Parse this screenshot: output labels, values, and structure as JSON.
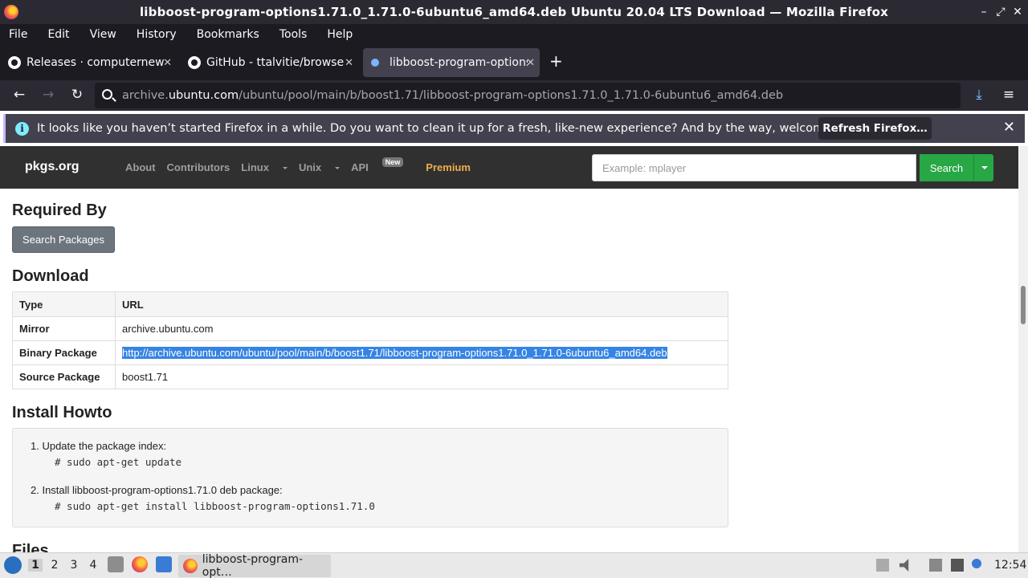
{
  "window": {
    "title": "libboost-program-options1.71.0_1.71.0-6ubuntu6_amd64.deb Ubuntu 20.04 LTS Download — Mozilla Firefox",
    "minimize": "–",
    "maximize": "⤢",
    "close": "✕"
  },
  "menu": [
    "File",
    "Edit",
    "View",
    "History",
    "Bookmarks",
    "Tools",
    "Help"
  ],
  "tabs": [
    {
      "label": "Releases · computernewb/",
      "close": "✕"
    },
    {
      "label": "GitHub - ttalvitie/browser",
      "close": "✕"
    },
    {
      "label": "libboost-program-options",
      "close": "✕"
    }
  ],
  "newtab": "+",
  "nav": {
    "back": "←",
    "forward": "→",
    "reload": "↻",
    "url_host_prefix": "archive.",
    "url_host": "ubuntu.com",
    "url_path": "/ubuntu/pool/main/b/boost1.71/libboost-program-options1.71.0_1.71.0-6ubuntu6_amd64.deb",
    "download": "⤓",
    "menu": "≡"
  },
  "notification": {
    "icon": "i",
    "message": "It looks like you haven’t started Firefox in a while. Do you want to clean it up for a fresh, like-new experience? And by the way, welcome back!",
    "button": "Refresh Firefox…",
    "close": "✕"
  },
  "site": {
    "brand": "pkgs.org",
    "links": {
      "about": "About",
      "contributors": "Contributors",
      "linux": "Linux",
      "unix": "Unix",
      "api": "API",
      "api_badge": "New",
      "premium": "Premium"
    },
    "search_placeholder": "Example: mplayer",
    "search_button": "Search"
  },
  "page": {
    "required_by": "Required By",
    "search_packages": "Search Packages",
    "download": "Download",
    "table_headers": [
      "Type",
      "URL"
    ],
    "rows": [
      {
        "type": "Mirror",
        "url": "archive.ubuntu.com"
      },
      {
        "type": "Binary Package",
        "url": "http://archive.ubuntu.com/ubuntu/pool/main/b/boost1.71/libboost-program-options1.71.0_1.71.0-6ubuntu6_amd64.deb"
      },
      {
        "type": "Source Package",
        "url": "boost1.71"
      }
    ],
    "install_howto": "Install Howto",
    "step1": "1. Update the package index:",
    "cmd1": "# sudo apt-get update",
    "step2": "2. Install libboost-program-options1.71.0 deb package:",
    "cmd2": "# sudo apt-get install libboost-program-options1.71.0",
    "files": "Files"
  },
  "taskbar": {
    "workspaces": [
      "1",
      "2",
      "3",
      "4"
    ],
    "window_label": "libboost-program-opt…",
    "clock": "12:54"
  }
}
